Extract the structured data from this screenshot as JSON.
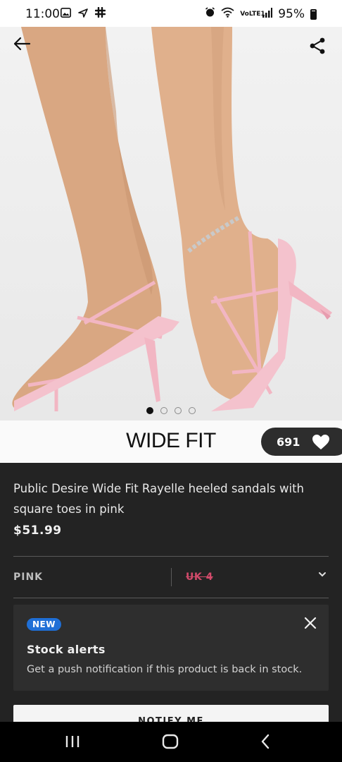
{
  "status_bar": {
    "time": "11:00",
    "battery": "95%",
    "network_label": "VoLTE1",
    "icons": [
      "gallery-icon",
      "airplane-icon",
      "slack-icon",
      "alarm-icon",
      "wifi-icon",
      "signal-icon",
      "battery-icon"
    ]
  },
  "gallery": {
    "image_description": "Pink square-toe stiletto heeled sandals worn on a model's feet with an ankle chain",
    "slide_count": 4,
    "active_slide": 1
  },
  "header": {
    "back_icon": "arrow-left-icon",
    "share_icon": "share-icon"
  },
  "brand": {
    "title": "WIDE FIT",
    "saved_count": "691",
    "heart_icon": "heart-icon"
  },
  "product": {
    "title": "Public Desire Wide Fit Rayelle heeled sandals with square toes in pink",
    "price": "$51.99",
    "colour": "PINK",
    "size": "UK 4",
    "size_chevron_icon": "chevron-down-icon"
  },
  "stock_alert": {
    "badge": "NEW",
    "title": "Stock alerts",
    "text": "Get a push notification if this product is back in stock.",
    "close_icon": "close-icon"
  },
  "notify_button": {
    "label": "NOTIFY ME"
  },
  "nav": {
    "recents_icon": "recents-icon",
    "home_icon": "home-icon",
    "back_icon": "back-icon"
  },
  "colors": {
    "background": "#232323",
    "brand_strip": "#fafafa",
    "badge_blue": "#1f6fd6",
    "size_strike_pink": "#d14a6a",
    "card": "#2e2e2e"
  }
}
